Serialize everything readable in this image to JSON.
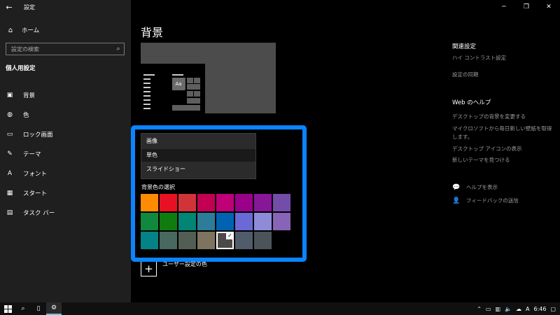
{
  "window": {
    "title": "設定",
    "back_icon": "back-arrow-icon",
    "controls": [
      "minimize",
      "restore",
      "close"
    ]
  },
  "sidebar": {
    "home_label": "ホーム",
    "search_placeholder": "設定の検索",
    "section_title": "個人用設定",
    "items": [
      {
        "label": "背景",
        "icon": "picture-icon"
      },
      {
        "label": "色",
        "icon": "palette-icon"
      },
      {
        "label": "ロック画面",
        "icon": "monitor-icon"
      },
      {
        "label": "テーマ",
        "icon": "theme-icon"
      },
      {
        "label": "フォント",
        "icon": "font-icon"
      },
      {
        "label": "スタート",
        "icon": "start-icon"
      },
      {
        "label": "タスク バー",
        "icon": "taskbar-icon"
      }
    ]
  },
  "main": {
    "page_title": "背景",
    "preview_sample_text": "Aa",
    "dropdown": {
      "options": [
        "画像",
        "単色",
        "スライドショー"
      ],
      "selected": "単色"
    },
    "color_section_label": "背景色の選択",
    "colors": [
      "#ff8c00",
      "#e81123",
      "#d13438",
      "#c30052",
      "#bf0077",
      "#9a0089",
      "#881798",
      "#744da9",
      "#10893e",
      "#107c10",
      "#018574",
      "#2d7d9a",
      "#0063b1",
      "#6b69d6",
      "#8e8cd8",
      "#8764b8",
      "#038387",
      "#486860",
      "#525e54",
      "#7e735f",
      "#4c4a48",
      "#515c6b",
      "#4a5459"
    ],
    "selected_color_index": 20,
    "custom_color_label": "ユーザー設定の色",
    "highlight_color": "#0a84ff"
  },
  "related": {
    "heading": "関連設定",
    "links": [
      "ハイ コントラスト設定",
      "設定の同期"
    ]
  },
  "web_help": {
    "heading": "Web のヘルプ",
    "links": [
      "デスクトップの背景を変更する",
      "マイクロソフトから毎日新しい壁紙を取得",
      "します。",
      "デスクトップ アイコンの表示",
      "新しいテーマを見つける"
    ]
  },
  "help_actions": [
    {
      "label": "ヘルプを表示",
      "icon": "help-chat-icon"
    },
    {
      "label": "フィードバックの送信",
      "icon": "feedback-icon"
    }
  ],
  "taskbar": {
    "clock": "6:46",
    "ime": "A"
  }
}
